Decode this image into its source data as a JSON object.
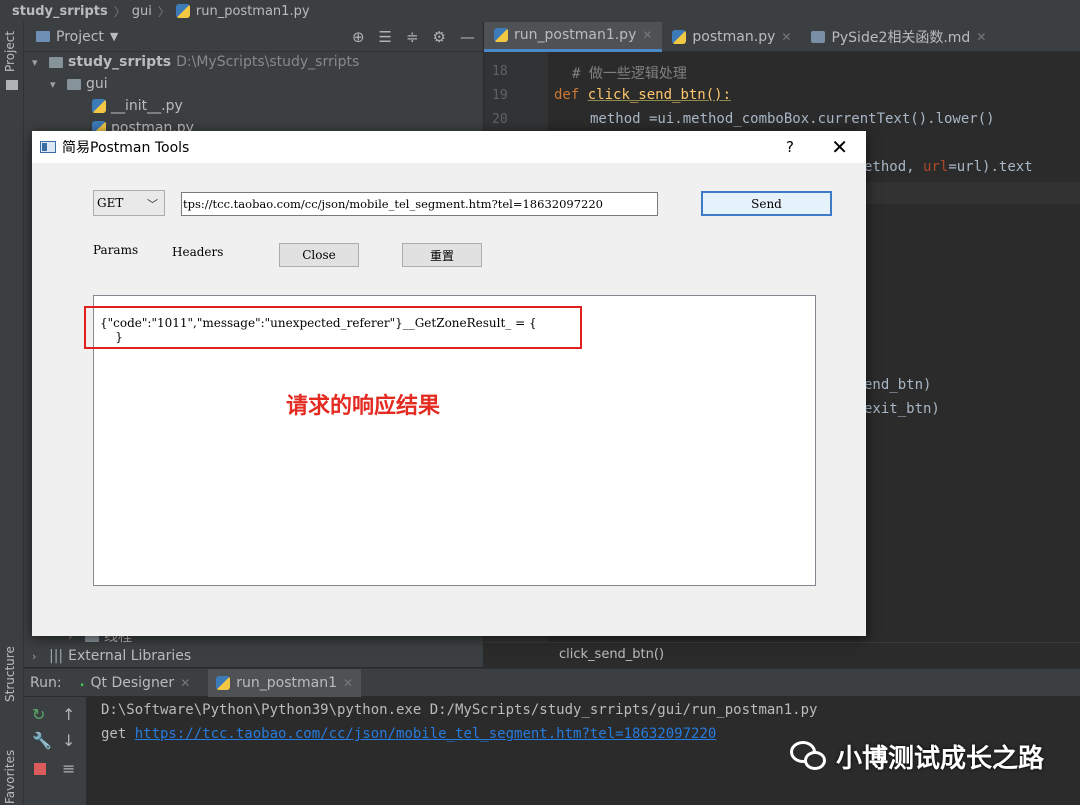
{
  "breadcrumb": [
    "study_srripts",
    "gui",
    "run_postman1.py"
  ],
  "side_strip": {
    "project": "Project",
    "structure": "Structure",
    "favorites": "Favorites"
  },
  "project_panel": {
    "title": "Project",
    "tree": [
      {
        "label": "study_srripts",
        "path": "D:\\MyScripts\\study_srripts"
      },
      {
        "label": "gui"
      },
      {
        "label": "__init__.py"
      },
      {
        "label": "postman.py"
      },
      {
        "label": "线程"
      },
      {
        "label": "External Libraries"
      }
    ]
  },
  "editor": {
    "tabs": [
      {
        "label": "run_postman1.py",
        "active": true
      },
      {
        "label": "postman.py",
        "active": false
      },
      {
        "label": "PySide2相关函数.md",
        "active": false
      }
    ],
    "line_numbers": [
      "18",
      "19",
      "20"
    ],
    "lines": {
      "l18_comment": "# 做一些逻辑处理",
      "l19_def": "def",
      "l19_name": "click_send_btn",
      "l19_tail": "():",
      "l20": "method =ui.method_comboBox.currentText().lower()",
      "l22_a": "ethod, ",
      "l22_param": "url",
      "l22_b": "=url).text",
      "l31": "end_btn)",
      "l32": "exit_btn)"
    },
    "breadcrumb_bottom": "click_send_btn()"
  },
  "run": {
    "label": "Run:",
    "tabs": [
      {
        "label": "Qt Designer",
        "active": false
      },
      {
        "label": "run_postman1",
        "active": true
      }
    ],
    "console": {
      "line1": "D:\\Software\\Python\\Python39\\python.exe D:/MyScripts/study_srripts/gui/run_postman1.py",
      "line2_prefix": "get ",
      "line2_link": "https://tcc.taobao.com/cc/json/mobile_tel_segment.htm?tel=18632097220"
    }
  },
  "dialog": {
    "title": "简易Postman Tools",
    "help": "?",
    "close": "✕",
    "method": "GET",
    "url": "tps://tcc.taobao.com/cc/json/mobile_tel_segment.htm?tel=18632097220",
    "send_label": "Send",
    "params_label": "Params",
    "headers_label": "Headers",
    "close_label": "Close",
    "reset_label": "重置",
    "response_text": "{\"code\":\"1011\",\"message\":\"unexpected_referer\"}__GetZoneResult_ = {\n    }",
    "annotation": "请求的响应结果"
  },
  "watermark": "小博测试成长之路",
  "colors": {
    "accent": "#4a88c7",
    "annotation_red": "#e0211f",
    "link": "#287bde"
  }
}
